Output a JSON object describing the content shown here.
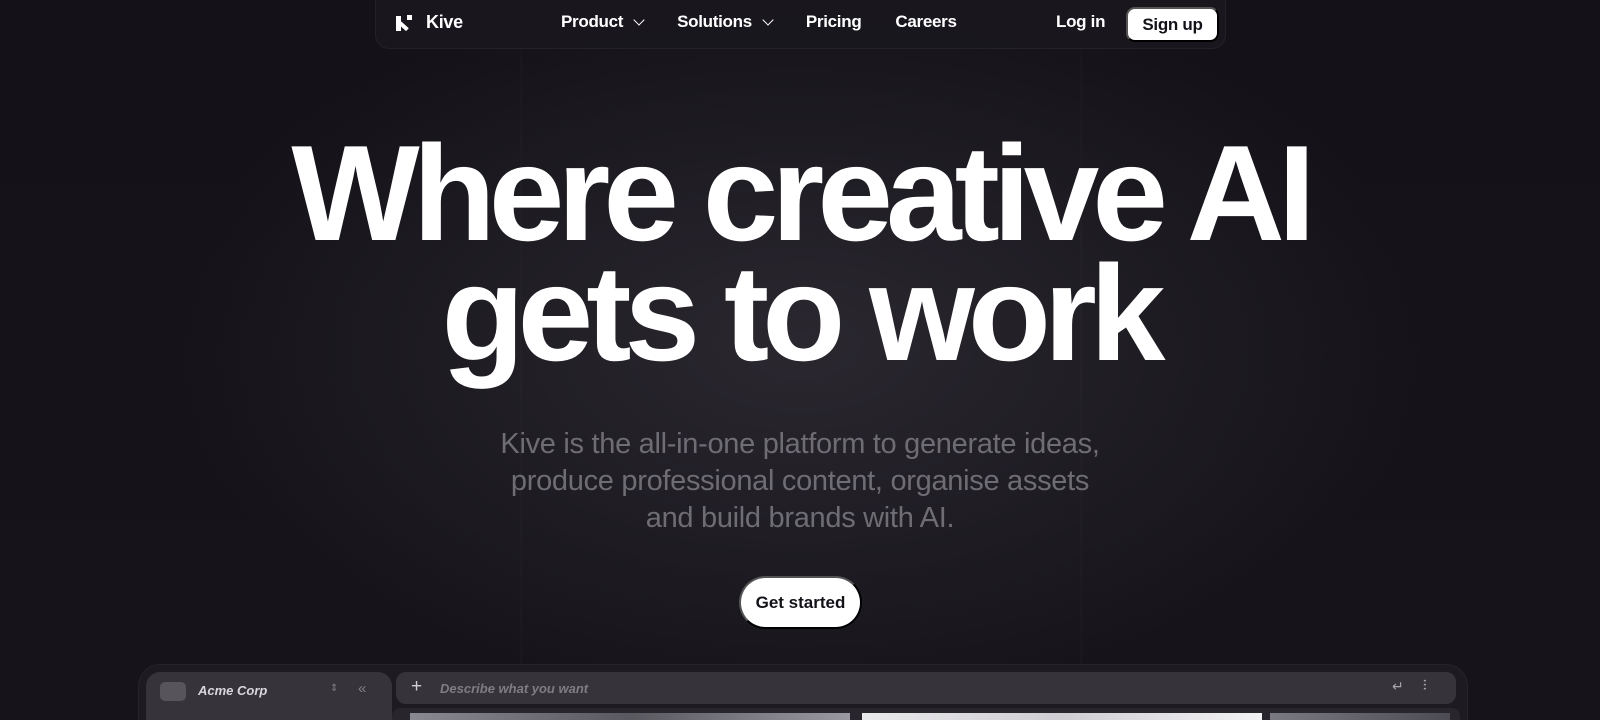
{
  "nav": {
    "logo_text": "Kive",
    "menu": [
      {
        "label": "Product",
        "has_dropdown": true
      },
      {
        "label": "Solutions",
        "has_dropdown": true
      },
      {
        "label": "Pricing",
        "has_dropdown": false
      },
      {
        "label": "Careers",
        "has_dropdown": false
      }
    ],
    "login_label": "Log in",
    "signup_label": "Sign up"
  },
  "hero": {
    "headline_line1": "Where creative AI",
    "headline_line2": "gets to work",
    "subtitle_line1": "Kive is the all-in-one platform to generate ideas,",
    "subtitle_line2": "produce professional content, organise assets",
    "subtitle_line3": "and build brands with AI.",
    "cta_label": "Get started"
  },
  "preview": {
    "workspace_name": "Acme Corp",
    "sort_icon": "sort-arrows-icon",
    "collapse_icon": "double-chevron-left-icon",
    "prompt_placeholder": "Describe what you want",
    "prompt_plus_icon": "plus-icon",
    "prompt_enter_icon": "enter-arrow-icon",
    "prompt_settings_icon": "sliders-icon"
  },
  "colors": {
    "background": "#141218",
    "text_primary": "#ffffff",
    "text_muted": "#6f6d74",
    "button_bg": "#ffffff",
    "button_text": "#141218"
  }
}
